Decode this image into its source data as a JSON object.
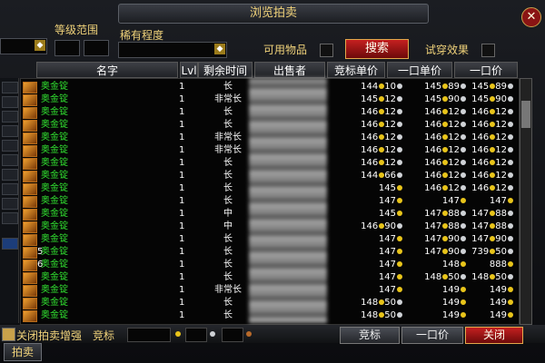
{
  "window": {
    "title": "浏览拍卖"
  },
  "filters": {
    "level_range_label": "等级范围",
    "rarity_label": "稀有程度",
    "usable_label": "可用物品",
    "search_label": "搜索",
    "try_on_label": "试穿效果"
  },
  "columns": {
    "name": "名字",
    "lvl": "Lvl",
    "time_left": "剩余时间",
    "seller": "出售者",
    "bid_unit": "竞标单价",
    "buyout_unit": "一口单价",
    "buyout": "一口价"
  },
  "rows": [
    {
      "qty": "",
      "name": "奥金锭",
      "lvl": "1",
      "time": "长",
      "bid": "144",
      "bid_s": "10",
      "ubo": "145",
      "ubo_s": "89",
      "bo": "145",
      "bo_s": "89"
    },
    {
      "qty": "",
      "name": "奥金锭",
      "lvl": "1",
      "time": "非常长",
      "bid": "145",
      "bid_s": "12",
      "ubo": "145",
      "ubo_s": "90",
      "bo": "145",
      "bo_s": "90"
    },
    {
      "qty": "",
      "name": "奥金锭",
      "lvl": "1",
      "time": "长",
      "bid": "146",
      "bid_s": "12",
      "ubo": "146",
      "ubo_s": "12",
      "bo": "146",
      "bo_s": "12"
    },
    {
      "qty": "",
      "name": "奥金锭",
      "lvl": "1",
      "time": "长",
      "bid": "146",
      "bid_s": "12",
      "ubo": "146",
      "ubo_s": "12",
      "bo": "146",
      "bo_s": "12"
    },
    {
      "qty": "",
      "name": "奥金锭",
      "lvl": "1",
      "time": "非常长",
      "bid": "146",
      "bid_s": "12",
      "ubo": "146",
      "ubo_s": "12",
      "bo": "146",
      "bo_s": "12"
    },
    {
      "qty": "",
      "name": "奥金锭",
      "lvl": "1",
      "time": "非常长",
      "bid": "146",
      "bid_s": "12",
      "ubo": "146",
      "ubo_s": "12",
      "bo": "146",
      "bo_s": "12"
    },
    {
      "qty": "",
      "name": "奥金锭",
      "lvl": "1",
      "time": "长",
      "bid": "146",
      "bid_s": "12",
      "ubo": "146",
      "ubo_s": "12",
      "bo": "146",
      "bo_s": "12"
    },
    {
      "qty": "",
      "name": "奥金锭",
      "lvl": "1",
      "time": "长",
      "bid": "144",
      "bid_s": "66",
      "ubo": "146",
      "ubo_s": "12",
      "bo": "146",
      "bo_s": "12"
    },
    {
      "qty": "",
      "name": "奥金锭",
      "lvl": "1",
      "time": "长",
      "bid": "145",
      "bid_s": "",
      "ubo": "146",
      "ubo_s": "12",
      "bo": "146",
      "bo_s": "12"
    },
    {
      "qty": "",
      "name": "奥金锭",
      "lvl": "1",
      "time": "长",
      "bid": "147",
      "bid_s": "",
      "ubo": "147",
      "ubo_s": "",
      "bo": "147",
      "bo_s": ""
    },
    {
      "qty": "",
      "name": "奥金锭",
      "lvl": "1",
      "time": "中",
      "bid": "145",
      "bid_s": "",
      "ubo": "147",
      "ubo_s": "88",
      "bo": "147",
      "bo_s": "88"
    },
    {
      "qty": "",
      "name": "奥金锭",
      "lvl": "1",
      "time": "中",
      "bid": "146",
      "bid_s": "90",
      "ubo": "147",
      "ubo_s": "88",
      "bo": "147",
      "bo_s": "88"
    },
    {
      "qty": "",
      "name": "奥金锭",
      "lvl": "1",
      "time": "长",
      "bid": "147",
      "bid_s": "",
      "ubo": "147",
      "ubo_s": "90",
      "bo": "147",
      "bo_s": "90"
    },
    {
      "qty": "5",
      "name": "奥金锭",
      "lvl": "1",
      "time": "长",
      "bid": "147",
      "bid_s": "",
      "ubo": "147",
      "ubo_s": "90",
      "bo": "739",
      "bo_s": "50"
    },
    {
      "qty": "6",
      "name": "奥金锭",
      "lvl": "1",
      "time": "长",
      "bid": "147",
      "bid_s": "",
      "ubo": "148",
      "ubo_s": "",
      "bo": "888",
      "bo_s": ""
    },
    {
      "qty": "",
      "name": "奥金锭",
      "lvl": "1",
      "time": "长",
      "bid": "147",
      "bid_s": "",
      "ubo": "148",
      "ubo_s": "50",
      "bo": "148",
      "bo_s": "50"
    },
    {
      "qty": "",
      "name": "奥金锭",
      "lvl": "1",
      "time": "非常长",
      "bid": "147",
      "bid_s": "",
      "ubo": "149",
      "ubo_s": "",
      "bo": "149",
      "bo_s": ""
    },
    {
      "qty": "",
      "name": "奥金锭",
      "lvl": "1",
      "time": "长",
      "bid": "148",
      "bid_s": "50",
      "ubo": "149",
      "ubo_s": "",
      "bo": "149",
      "bo_s": ""
    },
    {
      "qty": "",
      "name": "奥金锭",
      "lvl": "1",
      "time": "长",
      "bid": "148",
      "bid_s": "50",
      "ubo": "149",
      "ubo_s": "",
      "bo": "149",
      "bo_s": ""
    }
  ],
  "bottom": {
    "close_enhance": "关闭拍卖增强",
    "bid_label": "竞标",
    "bid_button": "竞标",
    "buyout_button": "一口价",
    "close_button": "关闭",
    "tab_auction": "拍卖"
  },
  "colors": {
    "item_name": "#31e030",
    "gold": "#e8c41a",
    "accent_red": "#c42020"
  }
}
